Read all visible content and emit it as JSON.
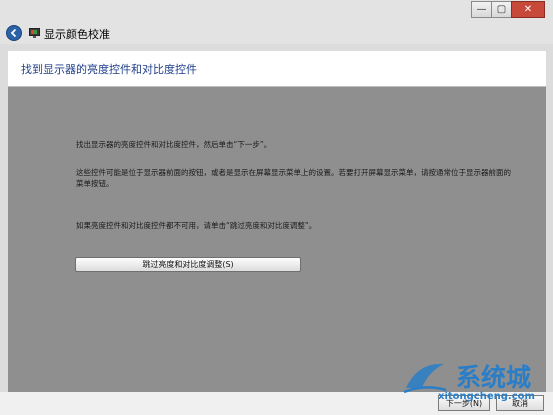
{
  "window": {
    "title": "显示颜色校准",
    "controls": {
      "minimize": "—",
      "maximize": "▢",
      "close": "✕"
    }
  },
  "header": {
    "title": "找到显示器的亮度控件和对比度控件"
  },
  "content": {
    "paragraph1": "找出显示器的亮度控件和对比度控件，然后单击“下一步”。",
    "paragraph2": "这些控件可能是位于显示器前面的按钮，或者是显示在屏幕显示菜单上的设置。若要打开屏幕显示菜单，请按通常位于显示器前面的菜单按钮。",
    "paragraph3": "如果亮度控件和对比度控件都不可用，请单击“跳过亮度和对比度调整”。",
    "skip_button": "跳过亮度和对比度调整(S)"
  },
  "footer": {
    "next": "下一步(N)",
    "cancel": "取消"
  },
  "watermark": {
    "text": "系统城",
    "sub": "xitongcheng.com"
  },
  "colors": {
    "content_bg": "#8f8f8f",
    "header_title": "#1f3e8a",
    "close_button": "#c7493a",
    "watermark": "#2a7ec8"
  }
}
